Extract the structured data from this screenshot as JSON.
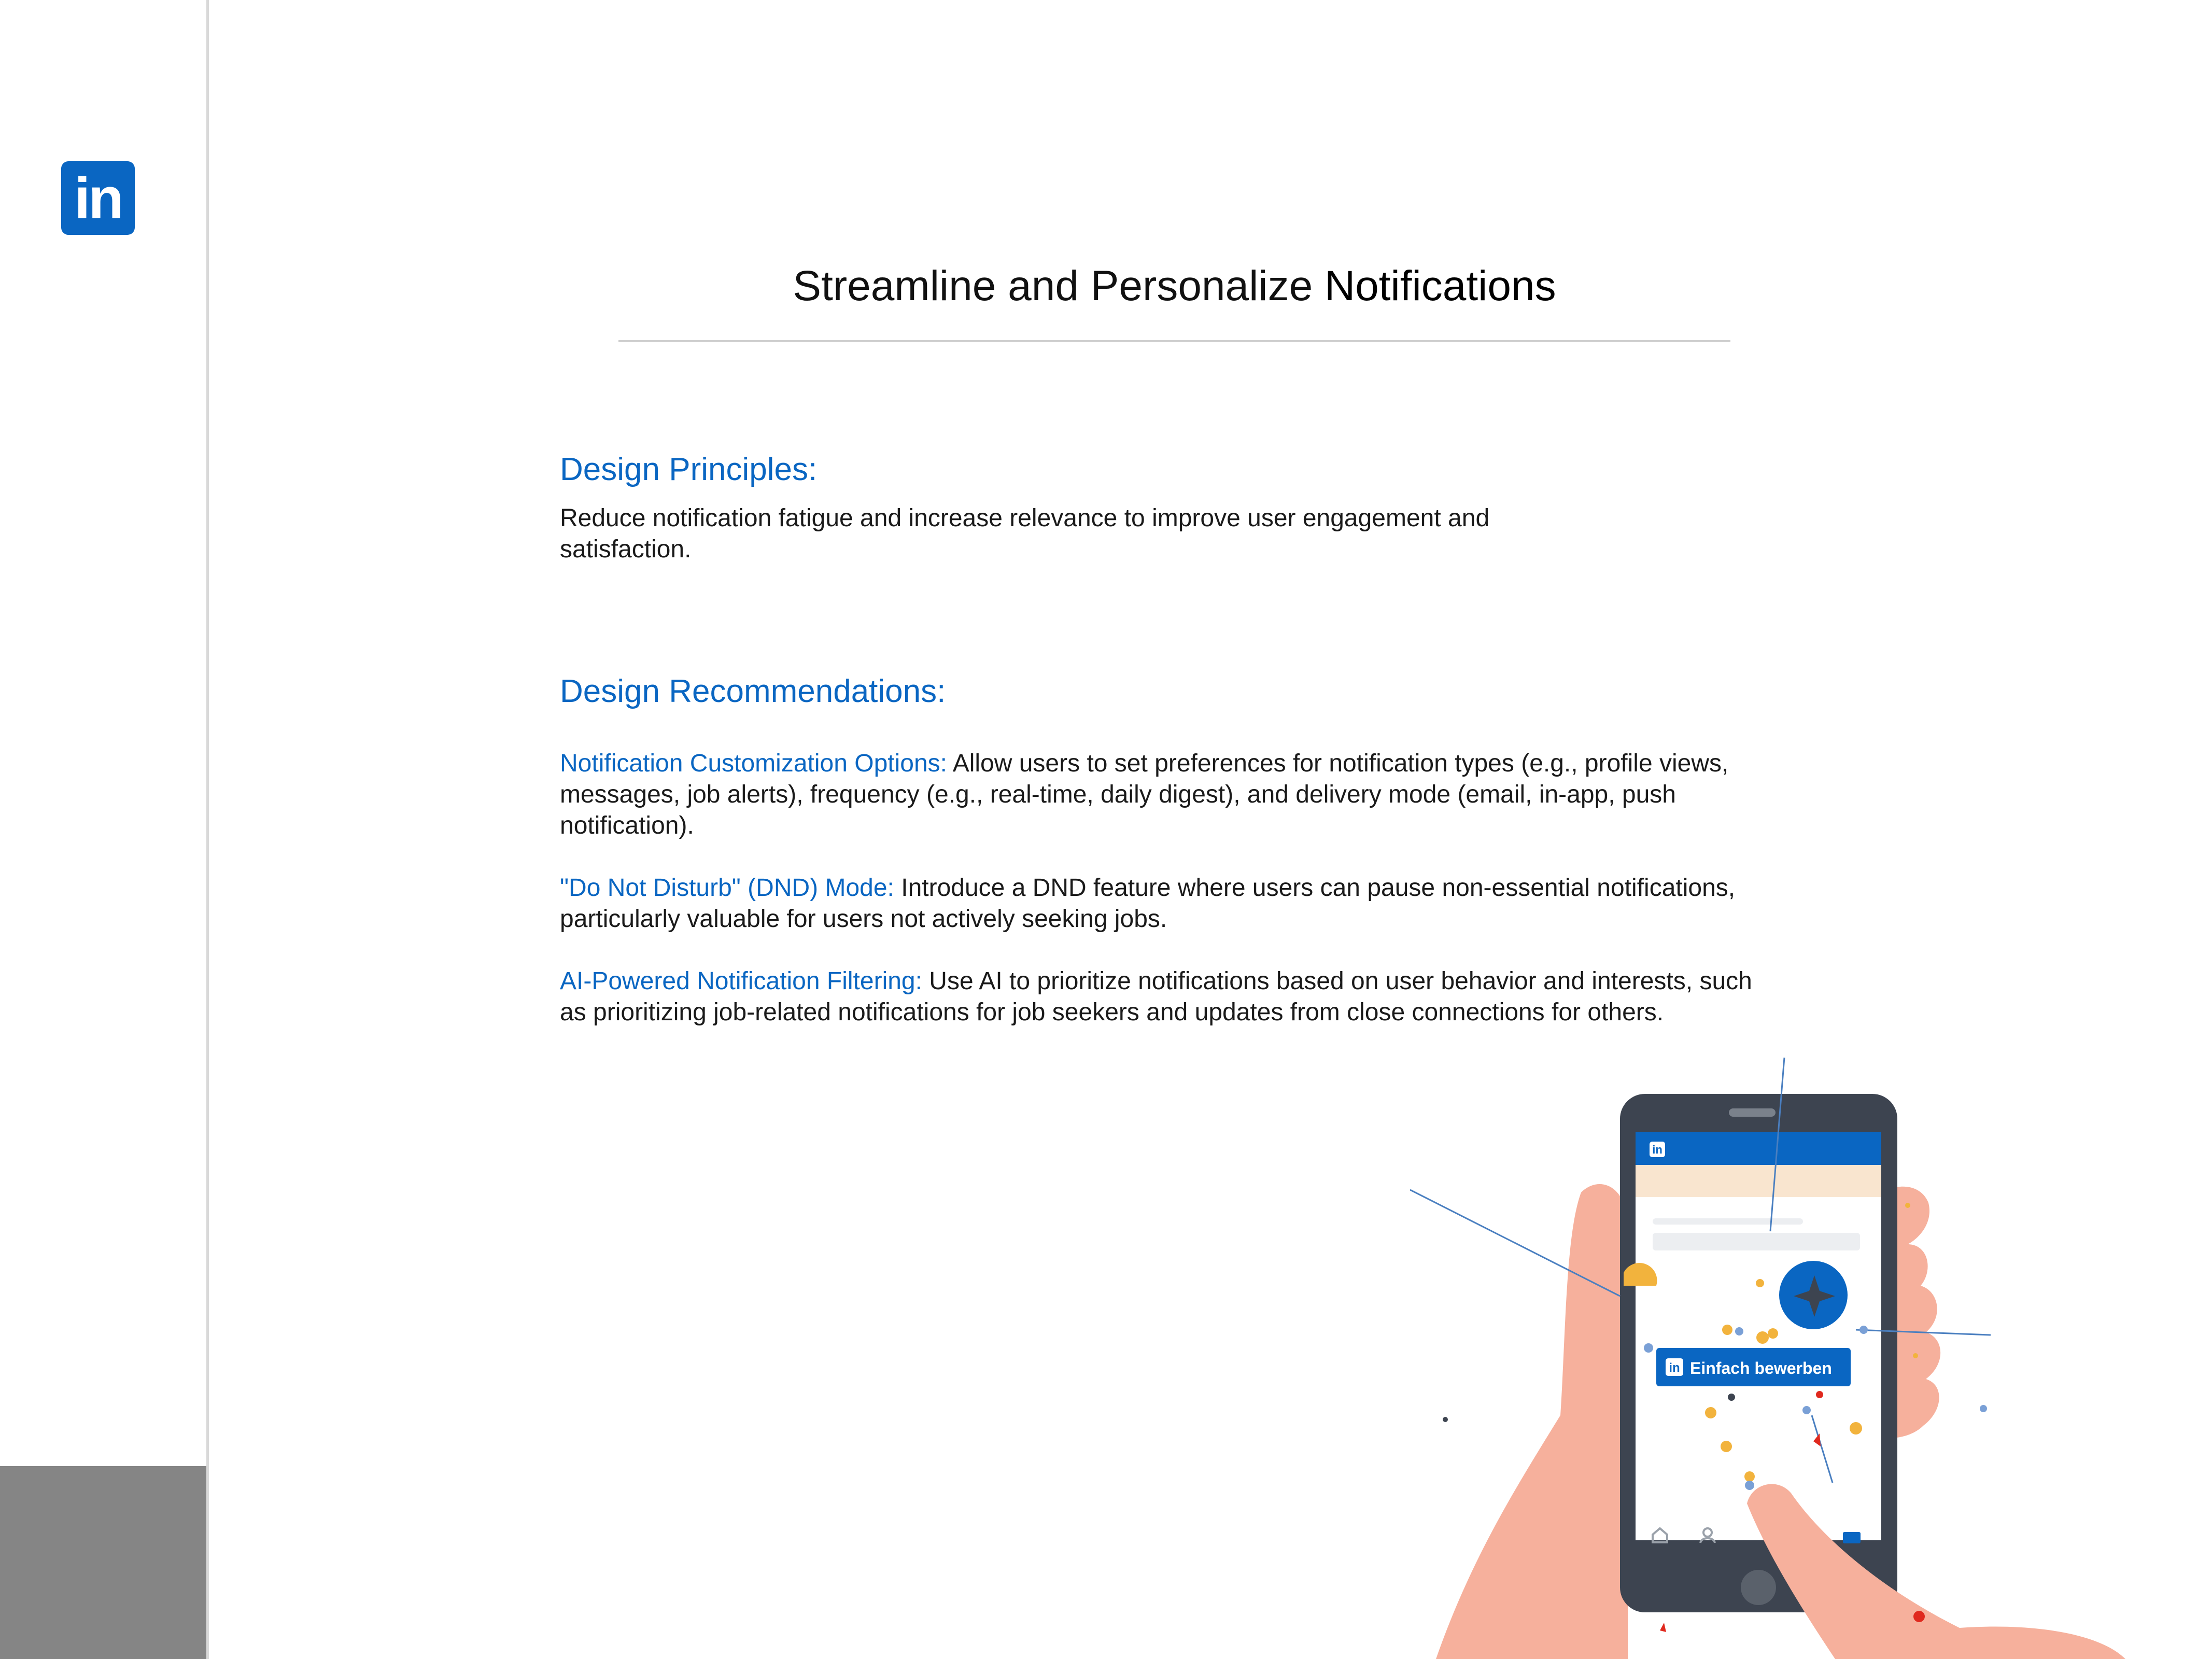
{
  "brand": {
    "logo_text": "in"
  },
  "title": {
    "prefix": "Streamline and Personalize ",
    "emphasis": "Notifications"
  },
  "design_principles": {
    "heading": "Design Principles:",
    "body": "Reduce notification fatigue and increase relevance to improve user engagement and satisfaction."
  },
  "design_recommendations": {
    "heading": "Design Recommendations:",
    "items": [
      {
        "lead": "Notification Customization Options:",
        "body": " Allow users to set preferences for notification types (e.g., profile views, messages, job alerts), frequency (e.g., real-time, daily digest), and delivery mode (email, in-app, push notification)."
      },
      {
        "lead": "\"Do Not Disturb\" (DND) Mode:",
        "body": " Introduce a DND feature where users can pause non-essential notifications, particularly valuable for users not actively seeking jobs."
      },
      {
        "lead": "AI-Powered Notification Filtering:",
        "body": " Use AI to prioritize notifications based on user behavior and interests, such as prioritizing job-related notifications for job seekers and updates from close connections for others."
      }
    ]
  },
  "illustration": {
    "phone_logo": "in",
    "apply_button": "Einfach bewerben"
  },
  "colors": {
    "accent": "#0a66c2",
    "skin": "#f6b09c",
    "phone": "#3d4450",
    "sidebar_block": "#858585"
  }
}
